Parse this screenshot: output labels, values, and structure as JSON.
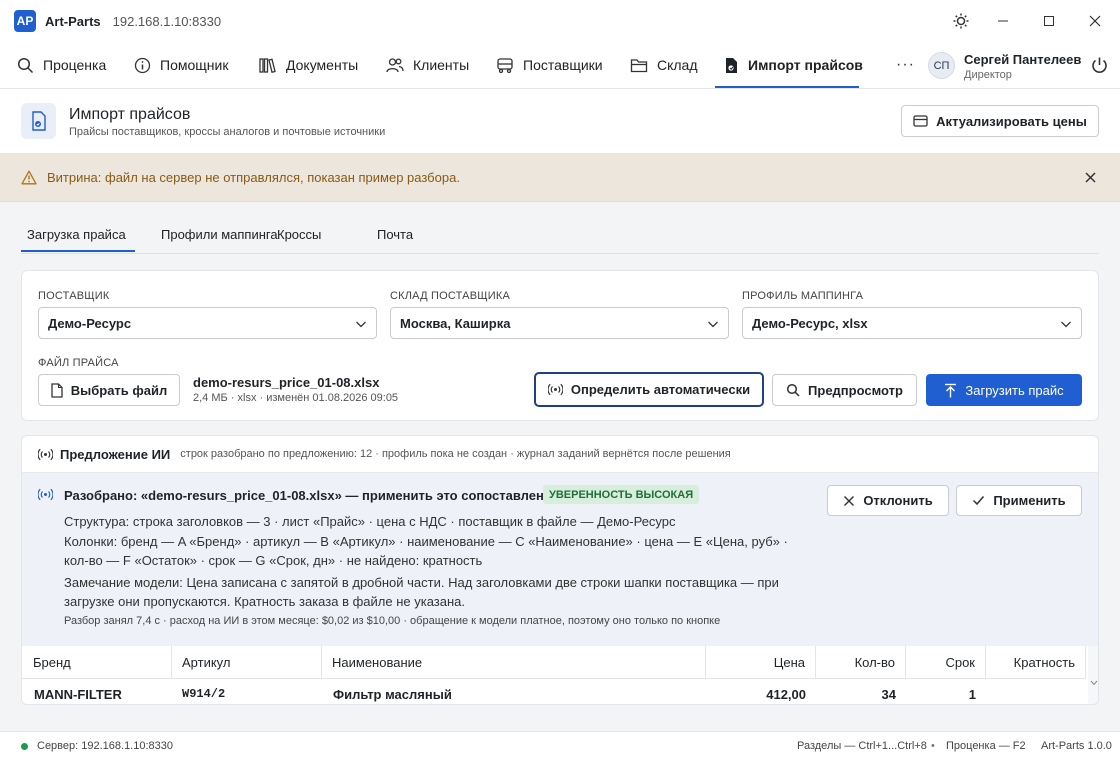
{
  "window": {
    "logo": "AP",
    "app_name": "Art-Parts",
    "address": "192.168.1.10:8330"
  },
  "nav": {
    "tabs": [
      {
        "label": "Проценка",
        "icon": "search-icon"
      },
      {
        "label": "Помощник",
        "icon": "info-icon"
      },
      {
        "label": "Документы",
        "icon": "books-icon"
      },
      {
        "label": "Клиенты",
        "icon": "users-icon"
      },
      {
        "label": "Поставщики",
        "icon": "truck-icon"
      },
      {
        "label": "Склад",
        "icon": "folder-icon"
      },
      {
        "label": "Импорт прайсов",
        "icon": "file-import-icon",
        "active": true
      }
    ],
    "more": "···",
    "user": {
      "initials": "СП",
      "name": "Сергей Пантелеев",
      "role": "Директор"
    }
  },
  "header": {
    "title": "Импорт прайсов",
    "subtitle": "Прайсы поставщиков, кроссы аналогов и почтовые источники",
    "action": "Актуализировать цены"
  },
  "banner": {
    "text": "Витрина: файл на сервер не отправлялся, показан пример разбора.",
    "color": "#8a5a12"
  },
  "subtabs": [
    "Загрузка прайса",
    "Профили маппинга",
    "Кроссы",
    "Почта"
  ],
  "form": {
    "supplier": {
      "label": "ПОСТАВЩИК",
      "value": "Демо-Ресурс"
    },
    "warehouse": {
      "label": "СКЛАД ПОСТАВЩИКА",
      "value": "Москва, Каширка"
    },
    "profile": {
      "label": "ПРОФИЛЬ МАППИНГА",
      "value": "Демо-Ресурс, xlsx"
    },
    "file": {
      "label": "ФАЙЛ ПРАЙСА",
      "choose": "Выбрать файл",
      "name": "demo-resurs_price_01-08.xlsx",
      "meta": "2,4 МБ · xlsx · изменён 01.08.2026 09:05"
    },
    "auto_detect": "Определить автоматически",
    "preview": "Предпросмотр",
    "upload": "Загрузить прайс"
  },
  "ai": {
    "title": "Предложение ИИ",
    "summary": "строк разобрано по предложению: 12 · профиль пока не создан · журнал заданий вернётся после решения",
    "question": "Разобрано: «demo-resurs_price_01-08.xlsx» — применить это сопоставление?",
    "confidence": "УВЕРЕННОСТЬ ВЫСОКАЯ",
    "structure": "Структура: строка заголовков — 3 · лист «Прайс» · цена с НДС · поставщик в файле — Демо-Ресурс",
    "columns": "Колонки: бренд — A «Бренд» · артикул — B «Артикул» · наименование — C «Наименование» · цена — E «Цена, руб» · кол-во — F «Остаток» · срок — G «Срок, дн» · не найдено: кратность",
    "note": "Замечание модели: Цена записана с запятой в дробной части. Над заголовками две строки шапки поставщика — при загрузке они пропускаются. Кратность заказа в файле не указана.",
    "footer": "Разбор занял 7,4 с · расход на ИИ в этом месяце: $0,02 из $10,00 · обращение к модели платное, поэтому оно только по кнопке",
    "reject": "Отклонить",
    "apply": "Применить"
  },
  "table": {
    "columns": [
      "Бренд",
      "Артикул",
      "Наименование",
      "Цена",
      "Кол-во",
      "Срок",
      "Кратность"
    ],
    "rows": [
      {
        "brand": "MANN-FILTER",
        "article": "W914/2",
        "name": "Фильтр масляный",
        "price": "412,00",
        "qty": "34",
        "term": "1",
        "multiplicity": ""
      }
    ]
  },
  "status": {
    "server": "Сервер: 192.168.1.10:8330",
    "hint_sections": "Разделы — Ctrl+1...Ctrl+8",
    "hint_search": "Проценка — F2",
    "version": "Art-Parts 1.0.0"
  }
}
